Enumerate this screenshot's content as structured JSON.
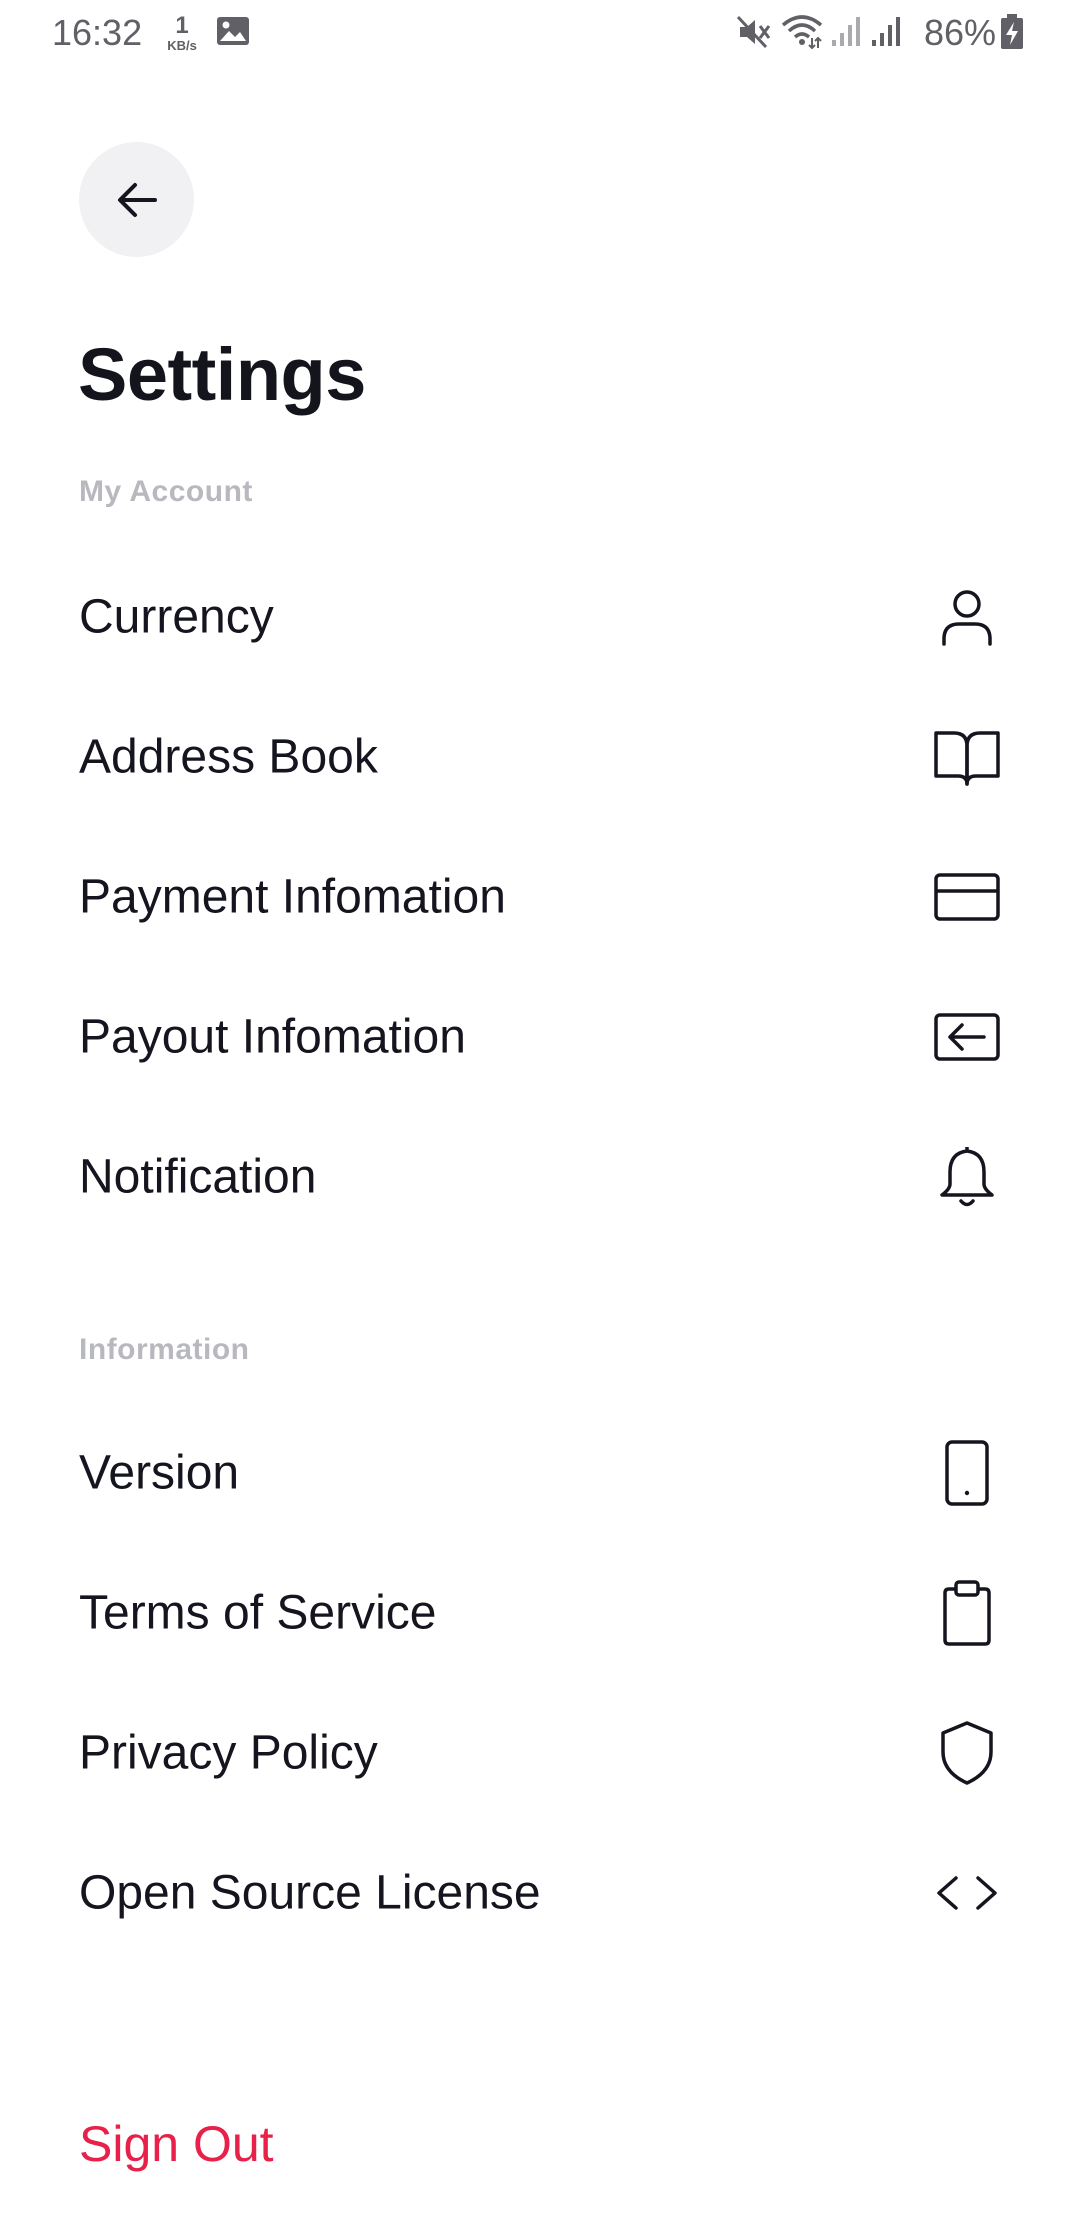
{
  "status_bar": {
    "time": "16:32",
    "net_speed_value": "1",
    "net_speed_unit": "KB/s",
    "battery": "86%",
    "icons": [
      "image-icon",
      "mute-icon",
      "wifi-icon",
      "signal-icon",
      "signal-icon",
      "battery-charging-icon"
    ]
  },
  "header": {
    "back_icon": "arrow-left-icon",
    "title": "Settings"
  },
  "sections": [
    {
      "label": "My Account",
      "items": [
        {
          "label": "Currency",
          "icon": "user-icon"
        },
        {
          "label": "Address Book",
          "icon": "book-icon"
        },
        {
          "label": "Payment Infomation",
          "icon": "credit-card-icon"
        },
        {
          "label": "Payout Infomation",
          "icon": "payout-icon"
        },
        {
          "label": "Notification",
          "icon": "bell-icon"
        }
      ]
    },
    {
      "label": "Information",
      "items": [
        {
          "label": "Version",
          "icon": "smartphone-icon"
        },
        {
          "label": "Terms of Service",
          "icon": "clipboard-icon"
        },
        {
          "label": "Privacy Policy",
          "icon": "shield-icon"
        },
        {
          "label": "Open Source License",
          "icon": "code-icon"
        }
      ]
    }
  ],
  "sign_out": "Sign Out",
  "colors": {
    "accent_red": "#e8214a",
    "text_primary": "#15151f",
    "section_label": "#b8b8bf",
    "back_button_bg": "#f1f1f3"
  }
}
